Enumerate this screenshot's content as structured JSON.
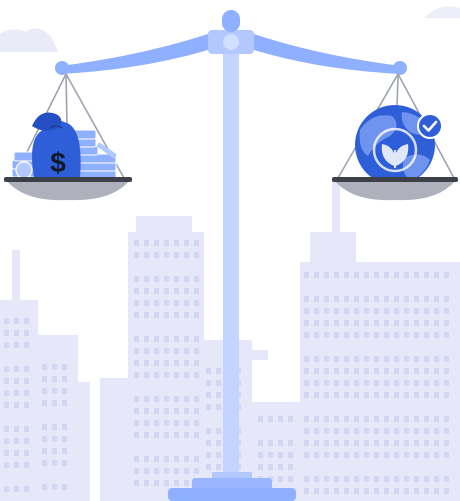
{
  "illustration": {
    "subject": "balance-scale",
    "left_pan": {
      "items": [
        "money-bag-icon",
        "coin-stack-icon"
      ],
      "bag_symbol": "$"
    },
    "right_pan": {
      "items": [
        "globe-icon",
        "leaf-emblem-icon",
        "check-badge-icon"
      ]
    },
    "background": "city-skyline"
  },
  "colors": {
    "primary_blue": "#2f5fd8",
    "light_blue": "#8fb0ff",
    "pale_blue": "#c2d4ff",
    "skyline": "#e6e8fa",
    "pan": "#aeb1bc",
    "pan_rim": "#3d3f49"
  }
}
